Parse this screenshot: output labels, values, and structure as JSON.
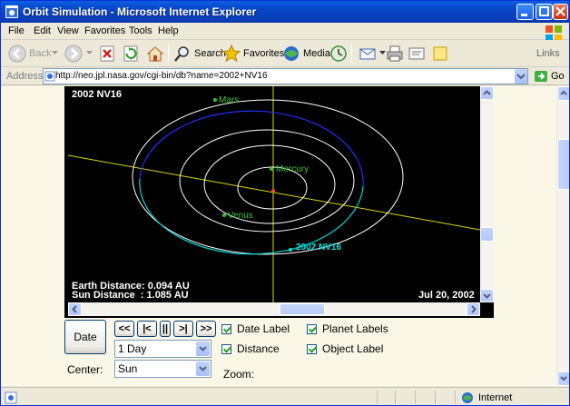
{
  "window": {
    "title": "Orbit Simulation - Microsoft Internet Explorer"
  },
  "menu": [
    "File",
    "Edit",
    "View",
    "Favorites",
    "Tools",
    "Help"
  ],
  "toolbar": {
    "back": "Back",
    "search": "Search",
    "favorites": "Favorites",
    "media": "Media",
    "links": "Links"
  },
  "address": {
    "label": "Address",
    "url": "http://neo.jpl.nasa.gov/cgi-bin/db?name=2002+NV16",
    "go": "Go"
  },
  "sim": {
    "object_name": "2002 NV16",
    "earth_distance": "Earth Distance: 0.094 AU",
    "sun_distance": "Sun Distance  : 1.085 AU",
    "date": "Jul 20, 2002",
    "planets": [
      "Mars",
      "Mercury",
      "Venus"
    ],
    "object_label": "2002 NV16",
    "colors": {
      "orbit": "#FFFFFF",
      "object_orbit": "#2030FF",
      "object_orbit_near": "#00D8D8",
      "axis": "#D8D800",
      "planet": "#3CC43C",
      "object": "#00E6E6",
      "sun": "#FF4020"
    }
  },
  "controls": {
    "date_button": "Date",
    "step_buttons": [
      "<<",
      "|<",
      "||",
      ">|",
      ">>"
    ],
    "step_select": "1 Day",
    "center_label": "Center:",
    "center_select": "Sun",
    "zoom_label": "Zoom:",
    "checkboxes": {
      "date_label": "Date Label",
      "distance": "Distance",
      "planet_labels": "Planet Labels",
      "object_label": "Object Label"
    }
  },
  "status": {
    "zone": "Internet"
  }
}
